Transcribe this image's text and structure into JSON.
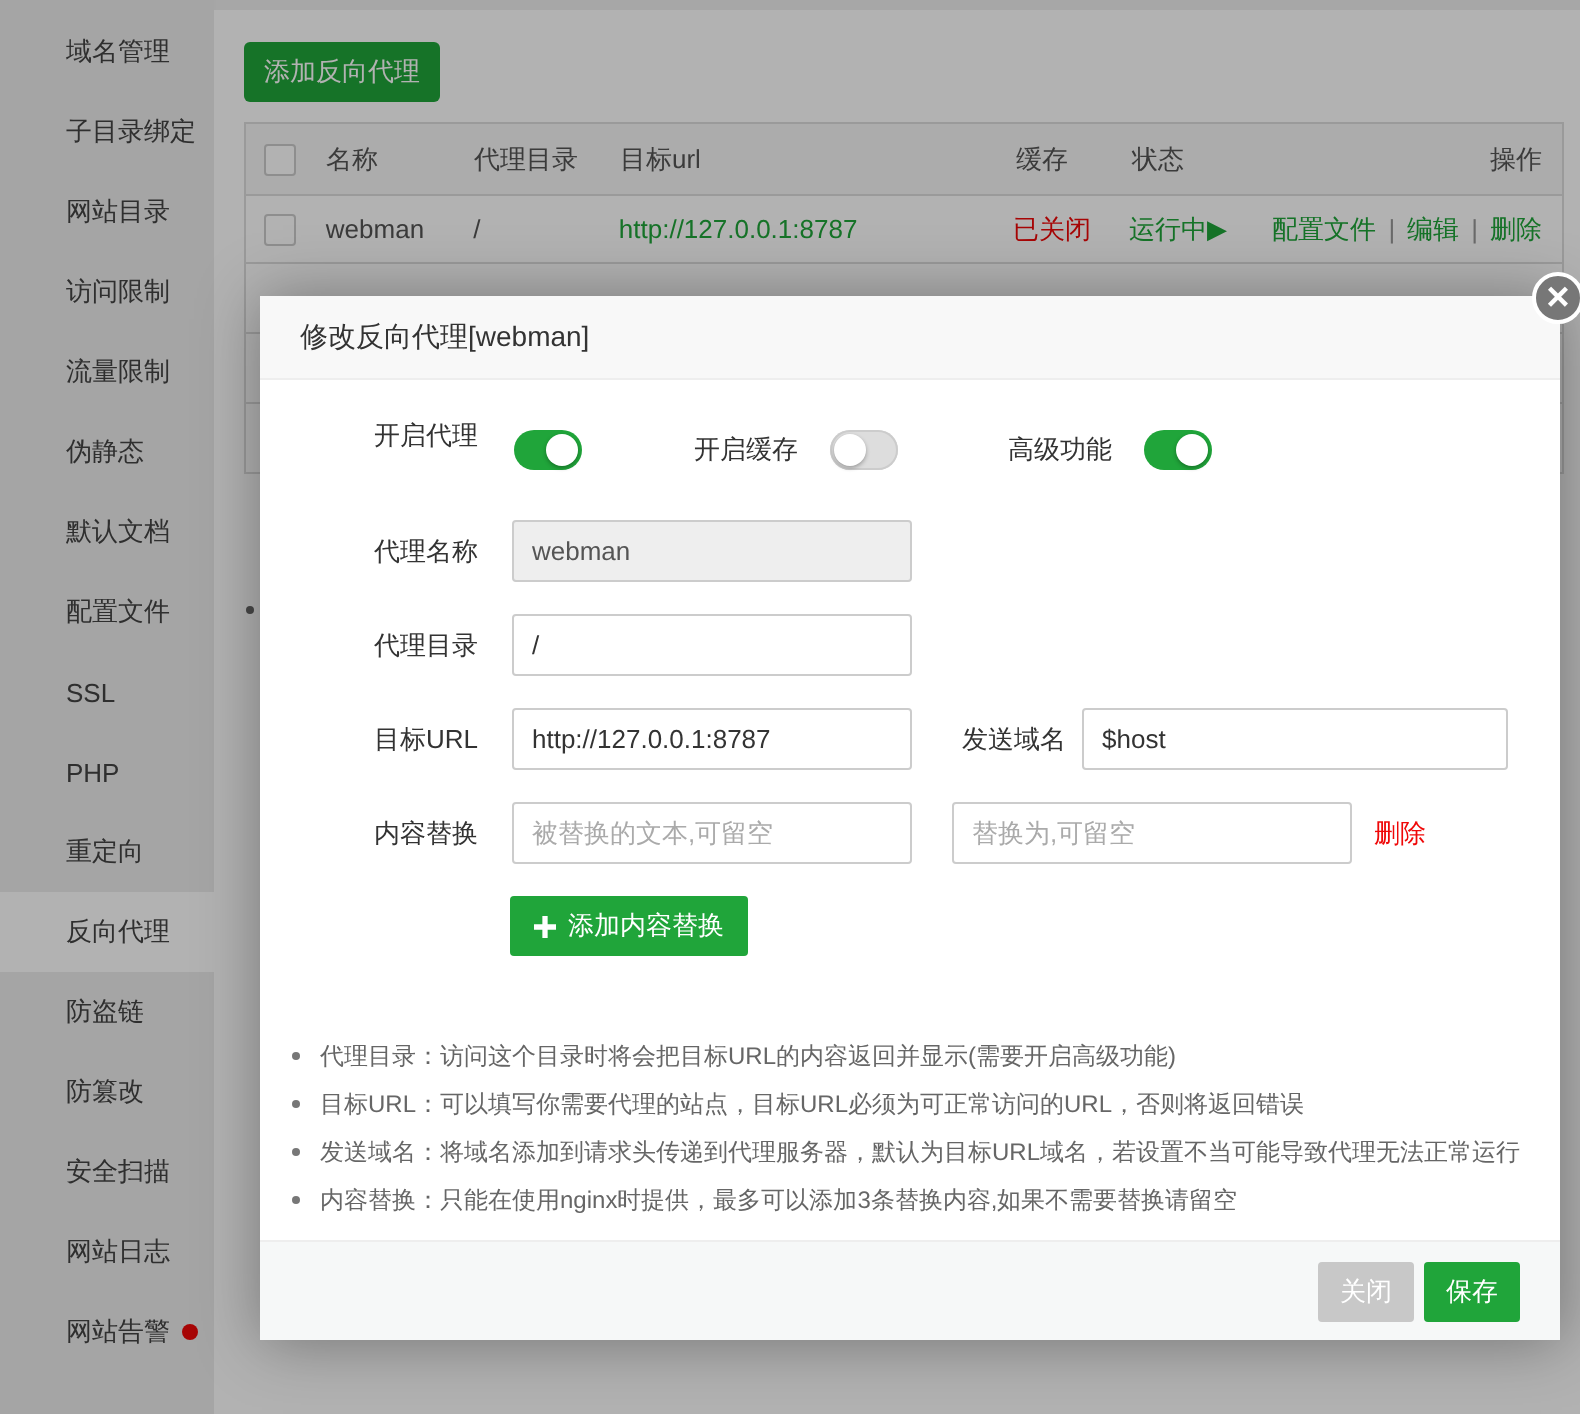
{
  "sidebar": {
    "items": [
      {
        "label": "域名管理",
        "selected": false,
        "alert": false
      },
      {
        "label": "子目录绑定",
        "selected": false,
        "alert": false
      },
      {
        "label": "网站目录",
        "selected": false,
        "alert": false
      },
      {
        "label": "访问限制",
        "selected": false,
        "alert": false
      },
      {
        "label": "流量限制",
        "selected": false,
        "alert": false
      },
      {
        "label": "伪静态",
        "selected": false,
        "alert": false
      },
      {
        "label": "默认文档",
        "selected": false,
        "alert": false
      },
      {
        "label": "配置文件",
        "selected": false,
        "alert": false
      },
      {
        "label": "SSL",
        "selected": false,
        "alert": false
      },
      {
        "label": "PHP",
        "selected": false,
        "alert": false
      },
      {
        "label": "重定向",
        "selected": false,
        "alert": false
      },
      {
        "label": "反向代理",
        "selected": true,
        "alert": false
      },
      {
        "label": "防盗链",
        "selected": false,
        "alert": false
      },
      {
        "label": "防篡改",
        "selected": false,
        "alert": false
      },
      {
        "label": "安全扫描",
        "selected": false,
        "alert": false
      },
      {
        "label": "网站日志",
        "selected": false,
        "alert": false
      },
      {
        "label": "网站告警",
        "selected": false,
        "alert": true
      }
    ]
  },
  "add_button": "添加反向代理",
  "table": {
    "select_all": {
      "checked": false
    },
    "columns": [
      "名称",
      "代理目录",
      "目标url",
      "缓存",
      "状态",
      "操作"
    ],
    "rows": [
      {
        "checked": false,
        "name": "webman",
        "dir": "/",
        "url": "http://127.0.0.1:8787",
        "cache": {
          "text": "已关闭",
          "on": false
        },
        "status": {
          "text": "运行中▶",
          "running": true
        },
        "actions": [
          "配置文件",
          "编辑",
          "删除"
        ],
        "separator": "|"
      }
    ]
  },
  "dialog": {
    "title": "修改反向代理[webman]",
    "close": "×",
    "toggles": [
      {
        "label": "开启代理",
        "on": true
      },
      {
        "label": "开启缓存",
        "on": false
      },
      {
        "label": "高级功能",
        "on": true
      }
    ],
    "fields": [
      {
        "label": "代理名称",
        "value": "webman",
        "disabled": true
      },
      {
        "label": "代理目录",
        "value": "/",
        "disabled": false
      },
      {
        "label": "目标URL",
        "value": "http://127.0.0.1:8787",
        "disabled": false,
        "extra": {
          "label": "发送域名",
          "value": "$host"
        }
      }
    ],
    "replace": {
      "label": "内容替换",
      "from_placeholder": "被替换的文本,可留空",
      "to_placeholder": "替换为,可留空",
      "delete": "删除"
    },
    "add_replace_button": "添加内容替换",
    "notes": [
      "代理目录：访问这个目录时将会把目标URL的内容返回并显示(需要开启高级功能)",
      "目标URL：可以填写你需要代理的站点，目标URL必须为可正常访问的URL，否则将返回错误",
      "发送域名：将域名添加到请求头传递到代理服务器，默认为目标URL域名，若设置不当可能导致代理无法正常运行",
      "内容替换：只能在使用nginx时提供，最多可以添加3条替换内容,如果不需要替换请留空"
    ],
    "buttons": [
      {
        "label": "关闭",
        "kind": "secondary"
      },
      {
        "label": "保存",
        "kind": "primary"
      }
    ]
  }
}
